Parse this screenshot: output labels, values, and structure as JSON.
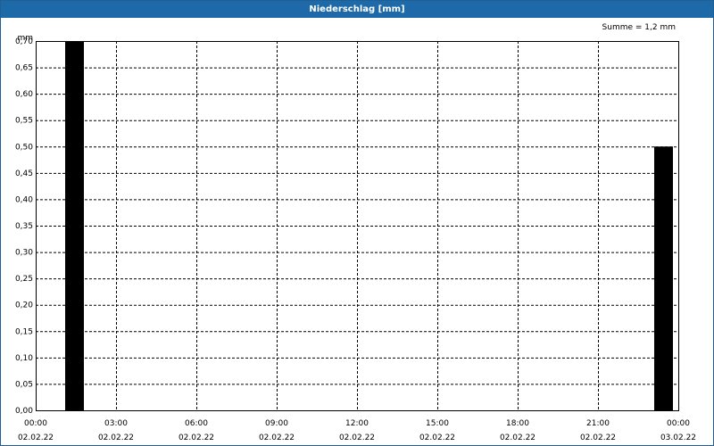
{
  "chart_data": {
    "type": "bar",
    "title": "Niederschlag [mm]",
    "annotation": "Summe = 1,2 mm",
    "ylabel": "mm",
    "ylim": [
      0,
      0.7
    ],
    "ytick_values": [
      0.0,
      0.05,
      0.1,
      0.15,
      0.2,
      0.25,
      0.3,
      0.35,
      0.4,
      0.45,
      0.5,
      0.55,
      0.6,
      0.65,
      0.7
    ],
    "ytick_labels": [
      "0,00",
      "0,05",
      "0,10",
      "0,15",
      "0,20",
      "0,25",
      "0,30",
      "0,35",
      "0,40",
      "0,45",
      "0,50",
      "0,55",
      "0,60",
      "0,65",
      "0,70"
    ],
    "xlim_hours": [
      0,
      24
    ],
    "xticks": [
      {
        "hours": 0,
        "time": "00:00",
        "date": "02.02.22"
      },
      {
        "hours": 3,
        "time": "03:00",
        "date": "02.02.22"
      },
      {
        "hours": 6,
        "time": "06:00",
        "date": "02.02.22"
      },
      {
        "hours": 9,
        "time": "09:00",
        "date": "02.02.22"
      },
      {
        "hours": 12,
        "time": "12:00",
        "date": "02.02.22"
      },
      {
        "hours": 15,
        "time": "15:00",
        "date": "02.02.22"
      },
      {
        "hours": 18,
        "time": "18:00",
        "date": "02.02.22"
      },
      {
        "hours": 21,
        "time": "21:00",
        "date": "02.02.22"
      },
      {
        "hours": 24,
        "time": "00:00",
        "date": "03.02.22"
      }
    ],
    "bars": [
      {
        "start_hours": 1.1,
        "end_hours": 1.8,
        "value": 0.7
      },
      {
        "start_hours": 23.1,
        "end_hours": 23.8,
        "value": 0.5
      }
    ],
    "bar_color": "#000000",
    "grid": true
  }
}
